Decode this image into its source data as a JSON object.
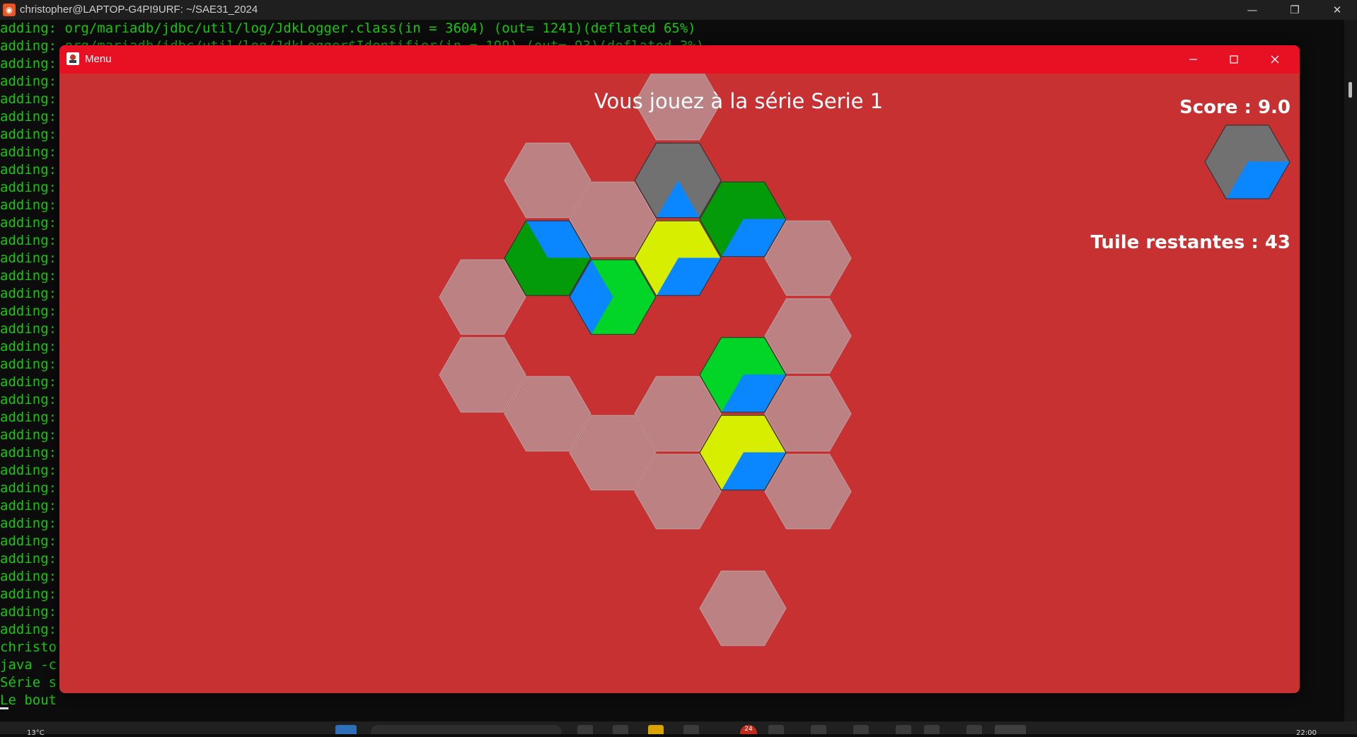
{
  "terminal": {
    "title": "christopher@LAPTOP-G4PI9URF: ~/SAE31_2024",
    "first_line": "adding: org/mariadb/jdbc/util/log/JdkLogger.class(in = 3604) (out= 1241)(deflated 65%)",
    "partial_line": "adding: org/mariadb/jdbc/util/log/JdkLogger$Identifier(in = 199) (out= 93)(deflated 3%)",
    "line_prefix": "adding:",
    "repeated_line_count": 33,
    "tail_lines": [
      "christo",
      "java -c",
      "Série s",
      "Le bout"
    ]
  },
  "taskbar": {
    "temperature": "13°C",
    "notification_badge": "24",
    "clock": "22:00"
  },
  "app": {
    "window_title": "Menu",
    "series_title": "Vous jouez à la série Serie 1",
    "score_label": "Score : 9.0",
    "remaining_label": "Tuile restantes : 43"
  },
  "colors": {
    "window_bg": "#c83132",
    "titlebar": "#e81123",
    "empty_slot": "#bc8182",
    "dark_green": "#039b0a",
    "light_green": "#02d428",
    "yellow": "#d7ee00",
    "blue": "#0a86ff",
    "gray": "#717171"
  },
  "board": {
    "empty_slots": [
      [
        3,
        0
      ],
      [
        2,
        1
      ],
      [
        4,
        1
      ],
      [
        1,
        1
      ],
      [
        5,
        2
      ],
      [
        0,
        2
      ],
      [
        5,
        3
      ],
      [
        0,
        3
      ],
      [
        1,
        4
      ],
      [
        2,
        4
      ],
      [
        3,
        4
      ],
      [
        5,
        4
      ],
      [
        3,
        5
      ],
      [
        5,
        5
      ],
      [
        4,
        6
      ]
    ],
    "tiles": [
      {
        "pos": [
          3,
          1
        ],
        "sectors": [
          "gray",
          "gray",
          "gray",
          "blue",
          "gray",
          "gray"
        ]
      },
      {
        "pos": [
          4,
          1
        ],
        "sectors": [
          "dark_green",
          "dark_green",
          "blue",
          "blue",
          "dark_green",
          "dark_green"
        ]
      },
      {
        "pos": [
          2,
          2
        ],
        "sectors": [
          "light_green",
          "light_green",
          "light_green",
          "light_green",
          "blue",
          "blue"
        ]
      },
      {
        "pos": [
          1,
          2
        ],
        "sectors": [
          "blue",
          "blue",
          "dark_green",
          "dark_green",
          "dark_green",
          "dark_green"
        ]
      },
      {
        "pos": [
          3,
          2
        ],
        "sectors": [
          "yellow",
          "yellow",
          "blue",
          "blue",
          "yellow",
          "yellow"
        ]
      },
      {
        "pos": [
          4,
          3
        ],
        "sectors": [
          "light_green",
          "light_green",
          "blue",
          "blue",
          "light_green",
          "light_green"
        ]
      },
      {
        "pos": [
          4,
          4
        ],
        "sectors": [
          "yellow",
          "yellow",
          "blue",
          "blue",
          "yellow",
          "yellow"
        ]
      }
    ],
    "next_tile": {
      "sectors": [
        "gray",
        "gray",
        "blue",
        "blue",
        "gray",
        "gray"
      ]
    }
  }
}
